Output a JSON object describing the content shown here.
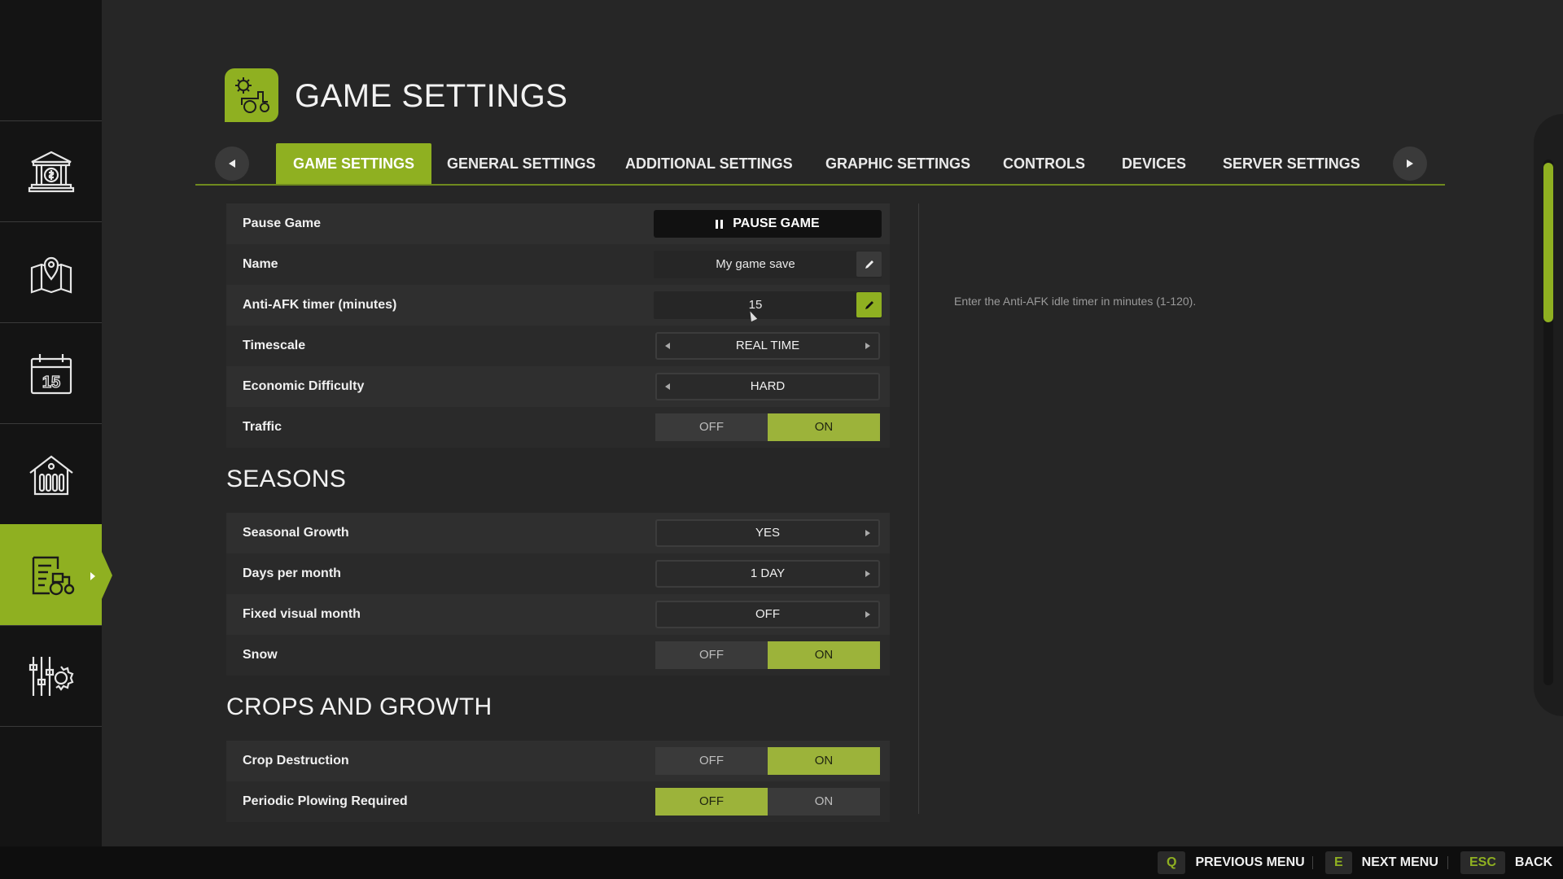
{
  "header": {
    "title": "GAME SETTINGS"
  },
  "tabs": [
    {
      "label": "GAME SETTINGS",
      "active": true
    },
    {
      "label": "GENERAL SETTINGS"
    },
    {
      "label": "ADDITIONAL SETTINGS"
    },
    {
      "label": "GRAPHIC SETTINGS"
    },
    {
      "label": "CONTROLS"
    },
    {
      "label": "DEVICES"
    },
    {
      "label": "SERVER SETTINGS"
    }
  ],
  "sidebar": {
    "items": [
      {
        "icon": "bank-icon"
      },
      {
        "icon": "map-icon"
      },
      {
        "icon": "calendar-icon",
        "text": "15"
      },
      {
        "icon": "barn-icon"
      },
      {
        "icon": "farm-settings-icon",
        "active": true
      },
      {
        "icon": "general-settings-icon"
      }
    ]
  },
  "game": {
    "pause": {
      "label": "Pause Game",
      "button": "PAUSE GAME"
    },
    "name": {
      "label": "Name",
      "value": "My game save"
    },
    "afk": {
      "label": "Anti-AFK timer (minutes)",
      "value": "15"
    },
    "timescale": {
      "label": "Timescale",
      "value": "REAL TIME"
    },
    "economic": {
      "label": "Economic Difficulty",
      "value": "HARD"
    },
    "traffic": {
      "label": "Traffic",
      "off": "OFF",
      "on": "ON",
      "state": "on"
    }
  },
  "seasons": {
    "title": "SEASONS",
    "growth": {
      "label": "Seasonal Growth",
      "value": "YES"
    },
    "days": {
      "label": "Days per month",
      "value": "1 DAY"
    },
    "fixed": {
      "label": "Fixed visual month",
      "value": "OFF"
    },
    "snow": {
      "label": "Snow",
      "off": "OFF",
      "on": "ON",
      "state": "on"
    }
  },
  "crops": {
    "title": "CROPS AND GROWTH",
    "destruction": {
      "label": "Crop Destruction",
      "off": "OFF",
      "on": "ON",
      "state": "on"
    },
    "plowing": {
      "label": "Periodic Plowing Required",
      "off": "OFF",
      "on": "ON",
      "state": "off"
    }
  },
  "help": {
    "text": "Enter the Anti-AFK idle timer in minutes (1-120)."
  },
  "footer": {
    "prev": {
      "key": "Q",
      "label": "PREVIOUS MENU"
    },
    "next": {
      "key": "E",
      "label": "NEXT MENU"
    },
    "back": {
      "key": "ESC",
      "label": "BACK"
    }
  },
  "colors": {
    "accent": "#8fb021",
    "toggle_on": "#9cb33a",
    "background": "#262626"
  }
}
